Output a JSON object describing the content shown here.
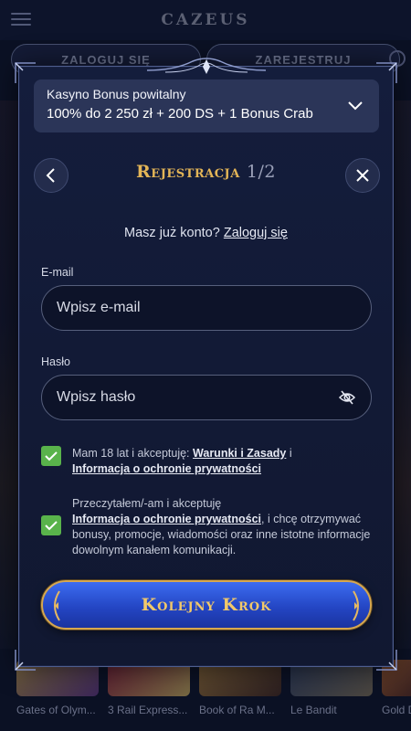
{
  "site": {
    "logo": "CAZEUS",
    "login_label": "ZALOGUJ SIĘ",
    "register_label": "ZAREJESTRUJ",
    "games": [
      "Gates of Olym...",
      "3 Rail Express...",
      "Book of Ra M...",
      "Le Bandit",
      "Gold D"
    ]
  },
  "bonus": {
    "title": "Kasyno Bonus powitalny",
    "value": "100% do 2 250 zł + 200 DS + 1 Bonus Crab"
  },
  "modal": {
    "title": "Rejestracja",
    "step": "1/2",
    "have_account": "Masz już konto?",
    "login_link": "Zaloguj się"
  },
  "form": {
    "email_label": "E-mail",
    "email_placeholder": "Wpisz e-mail",
    "password_label": "Hasło",
    "password_placeholder": "Wpisz hasło"
  },
  "consents": {
    "terms_prefix": "Mam 18 lat i akceptuję:",
    "terms_link": "Warunki i Zasady",
    "terms_and": "i",
    "privacy_link": "Informacja o ochronie prywatności",
    "marketing_prefix": "Przeczytałem/-am i akceptuję",
    "marketing_link": "Informacja o ochronie prywatności",
    "marketing_suffix": ", i chcę otrzymywać bonusy, promocje, wiadomości oraz inne istotne informacje dowolnym kanałem komunikacji."
  },
  "cta": {
    "label": "Kolejny Krok"
  },
  "colors": {
    "accent_gold": "#e3b557",
    "check_green": "#59b34b",
    "cta_blue": "#2a4fd0"
  }
}
